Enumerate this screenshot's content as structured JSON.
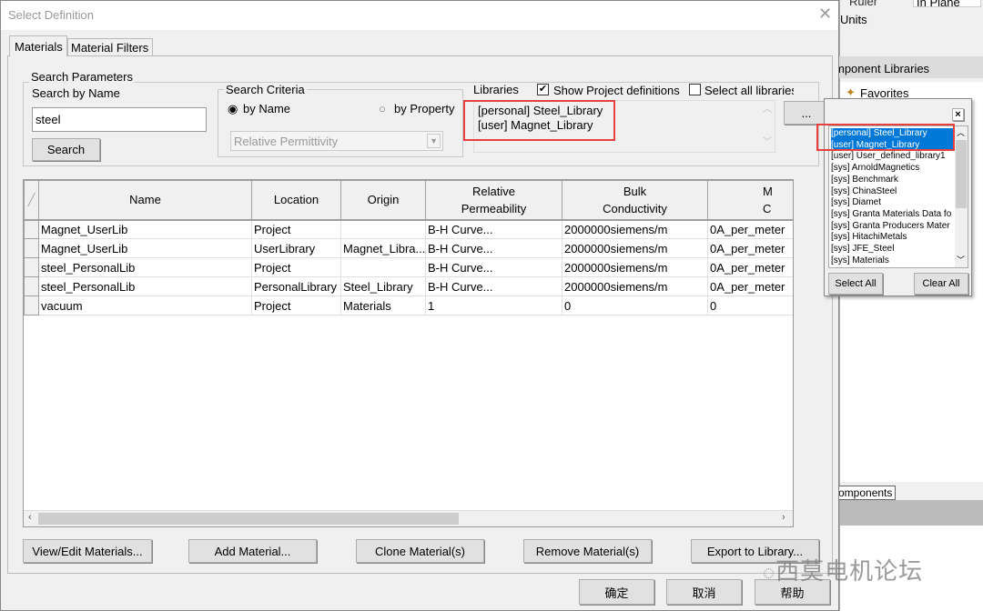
{
  "background": {
    "ruler": "Ruler",
    "inplane": "In Plane",
    "units": "Units",
    "component_libraries": "mponent Libraries",
    "favorites": "Favorites",
    "components_tab": "omponents"
  },
  "dialog": {
    "title": "Select Definition",
    "tabs": [
      {
        "label": "Materials",
        "active": true
      },
      {
        "label": "Material Filters",
        "active": false
      }
    ],
    "search_params": {
      "group": "Search Parameters",
      "by_name_label": "Search by Name",
      "input_value": "steel",
      "search_button": "Search"
    },
    "criteria": {
      "group": "Search Criteria",
      "by_name": "by Name",
      "by_property": "by Property",
      "selected": "by Name",
      "property_select": "Relative Permittivity"
    },
    "libraries": {
      "label": "Libraries",
      "show_project": "Show Project definitions",
      "show_project_checked": true,
      "select_all": "Select all libraries",
      "select_all_checked": false,
      "items": [
        "[personal] Steel_Library",
        "[user] Magnet_Library"
      ],
      "more_button": "..."
    },
    "table": {
      "columns": [
        "",
        "Name",
        "Location",
        "Origin",
        "Relative\nPermeability",
        "Bulk\nConductivity",
        "M\nC"
      ],
      "rows": [
        [
          "Magnet_UserLib",
          "Project",
          "",
          "B-H Curve...",
          "2000000siemens/m",
          "0A_per_meter"
        ],
        [
          "Magnet_UserLib",
          "UserLibrary",
          "Magnet_Libra...",
          "B-H Curve...",
          "2000000siemens/m",
          "0A_per_meter"
        ],
        [
          "steel_PersonalLib",
          "Project",
          "",
          "B-H Curve...",
          "2000000siemens/m",
          "0A_per_meter"
        ],
        [
          "steel_PersonalLib",
          "PersonalLibrary",
          "Steel_Library",
          "B-H Curve...",
          "2000000siemens/m",
          "0A_per_meter"
        ],
        [
          "vacuum",
          "Project",
          "Materials",
          "1",
          "0",
          "0"
        ]
      ]
    },
    "buttons": {
      "view_edit": "View/Edit Materials...",
      "add": "Add Material...",
      "clone": "Clone Material(s)",
      "remove": "Remove Material(s)",
      "export": "Export to Library..."
    },
    "footer": {
      "ok": "确定",
      "cancel": "取消",
      "help": "帮助"
    }
  },
  "popup": {
    "close": "×",
    "items": [
      {
        "label": "[personal] Steel_Library",
        "selected": true
      },
      {
        "label": "[user] Magnet_Library",
        "selected": true
      },
      {
        "label": "[user] User_defined_library1",
        "selected": false
      },
      {
        "label": "[sys] ArnoldMagnetics",
        "selected": false
      },
      {
        "label": "[sys] Benchmark",
        "selected": false
      },
      {
        "label": "[sys] ChinaSteel",
        "selected": false
      },
      {
        "label": "[sys] Diamet",
        "selected": false
      },
      {
        "label": "[sys] Granta Materials Data fo",
        "selected": false
      },
      {
        "label": "[sys] Granta Producers Mater",
        "selected": false
      },
      {
        "label": "[sys] HitachiMetals",
        "selected": false
      },
      {
        "label": "[sys] JFE_Steel",
        "selected": false
      },
      {
        "label": "[sys] Materials",
        "selected": false
      }
    ],
    "select_all": "Select All",
    "clear_all": "Clear All"
  },
  "watermark": "西莫电机论坛",
  "colors": {
    "selection": "#0078d7",
    "highlight_box": "#e8403c"
  }
}
